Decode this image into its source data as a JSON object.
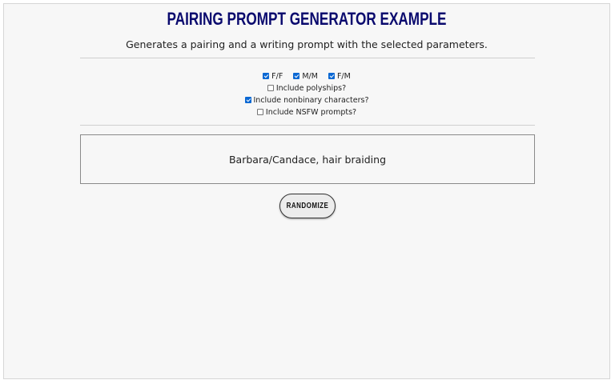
{
  "page": {
    "title": "Pairing Prompt Generator Example",
    "subtitle": "Generates a pairing and a writing prompt with the selected parameters."
  },
  "options": {
    "ff": {
      "label": "F/F",
      "checked": true
    },
    "mm": {
      "label": "M/M",
      "checked": true
    },
    "fm": {
      "label": "F/M",
      "checked": true
    },
    "polyships": {
      "label": "Include polyships?",
      "checked": false
    },
    "nonbinary": {
      "label": "Include nonbinary characters?",
      "checked": true
    },
    "nsfw": {
      "label": "Include NSFW prompts?",
      "checked": false
    }
  },
  "result": {
    "text": "Barbara/Candace, hair braiding"
  },
  "actions": {
    "randomize_label": "Randomize"
  },
  "colors": {
    "title": "#0a0a6e",
    "checkbox_checked": "#0b68d3",
    "panel_bg": "#f7f7f7"
  }
}
